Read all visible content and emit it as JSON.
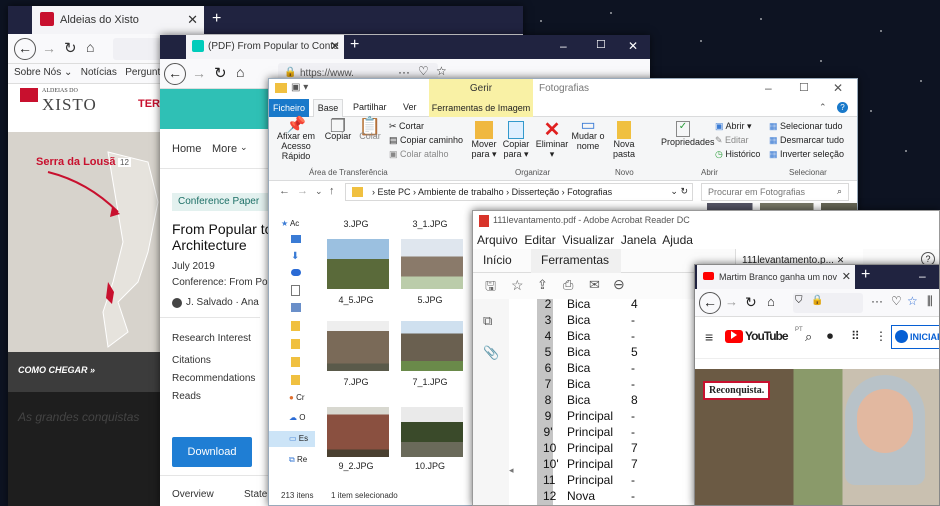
{
  "windows": {
    "aldeias": {
      "tab_title": "Aldeias do Xisto",
      "bookmarks": [
        "Sobre Nós ⌄",
        "Notícias",
        "Pergunt"
      ],
      "logo_small": "ALDEIAS DO",
      "logo_big": "XISTO",
      "nav_partial": "TER",
      "map_label": "Serra da Lousã",
      "map_count": "12",
      "como_chegar": "COMO CHEGAR »",
      "faded_text": "As grandes conquistas"
    },
    "researchgate": {
      "tab_title": "(PDF) From Popular to Conte",
      "url": "https://www.",
      "nav_home": "Home",
      "nav_more": "More",
      "badge": "Conference Paper",
      "title_line1": "From Popular to C",
      "title_line2": "Architecture",
      "date": "July 2019",
      "conference": "Conference: From Popu",
      "authors": "J. Salvado · Ana",
      "research_interest": "Research Interest",
      "citations": "Citations",
      "recommendations": "Recommendations",
      "reads": "Reads",
      "download": "Download",
      "tab_overview": "Overview",
      "tab_stats": "State"
    },
    "explorer": {
      "title": "Fotografias",
      "manage": "Gerir",
      "ribbon_tabs": [
        "Ficheiro",
        "Base",
        "Partilhar",
        "Ver",
        "Ferramentas de Imagem"
      ],
      "buttons": {
        "pin": "Afixar em Acesso Rápido",
        "copy": "Copiar",
        "paste": "Colar",
        "cut": "Cortar",
        "copy_path": "Copiar caminho",
        "paste_shortcut": "Colar atalho",
        "move_to": "Mover para ▾",
        "copy_to": "Copiar para ▾",
        "delete": "Eliminar ▾",
        "rename": "Mudar o nome",
        "new_folder": "Nova pasta",
        "properties": "Propriedades",
        "open": "Abrir ▾",
        "edit": "Editar",
        "history": "Histórico",
        "select_all": "Selecionar tudo",
        "select_none": "Desmarcar tudo",
        "invert": "Inverter seleção"
      },
      "groups": [
        "Área de Transferência",
        "Organizar",
        "Novo",
        "Abrir",
        "Selecionar"
      ],
      "breadcrumb": [
        "Este PC",
        "Ambiente de trabalho",
        "Disserteção",
        "Fotografias"
      ],
      "search_placeholder": "Procurar em Fotografias",
      "sidebar": [
        "Ac",
        "Cr",
        "O",
        "Es",
        "Re"
      ],
      "files": [
        {
          "name": "3.JPG"
        },
        {
          "name": "3_1.JPG"
        },
        {
          "name": "4_5.JPG"
        },
        {
          "name": "5.JPG"
        },
        {
          "name": "7.JPG"
        },
        {
          "name": "7_1.JPG"
        },
        {
          "name": "9_2.JPG"
        },
        {
          "name": "10.JPG"
        }
      ],
      "status_count": "213 itens",
      "status_selected": "1 item selecionado"
    },
    "acrobat": {
      "title": "111levantamento.pdf - Adobe Acrobat Reader DC",
      "menu": [
        "Arquivo",
        "Editar",
        "Visualizar",
        "Janela",
        "Ajuda"
      ],
      "tabs": [
        "Início",
        "Ferramentas"
      ],
      "doc_tab": "111levantamento.p...",
      "rows": [
        {
          "n": "2",
          "type": "Bica",
          "v": "4"
        },
        {
          "n": "3",
          "type": "Bica",
          "v": "-"
        },
        {
          "n": "4",
          "type": "Bica",
          "v": "-"
        },
        {
          "n": "5",
          "type": "Bica",
          "v": "5"
        },
        {
          "n": "6",
          "type": "Bica",
          "v": "-"
        },
        {
          "n": "7",
          "type": "Bica",
          "v": "-"
        },
        {
          "n": "8",
          "type": "Bica",
          "v": "8"
        },
        {
          "n": "9",
          "type": "Principal",
          "v": "-"
        },
        {
          "n": "9'",
          "type": "Principal",
          "v": "-"
        },
        {
          "n": "10",
          "type": "Principal",
          "v": "7"
        },
        {
          "n": "10'",
          "type": "Principal",
          "v": "7"
        },
        {
          "n": "11",
          "type": "Principal",
          "v": "-"
        },
        {
          "n": "12",
          "type": "Nova",
          "v": "-"
        }
      ]
    },
    "youtube": {
      "tab_title": "Martim Branco ganha um nov",
      "logo_text": "YouTube",
      "logo_sup": "PT",
      "signin": "INICIAR S",
      "video_caption": "Reconquista."
    }
  },
  "colors": {
    "taskbar": "#202340",
    "accent": "#1f7ed4",
    "youtube_red": "#ff0000",
    "aldeias_red": "#c8102e"
  }
}
